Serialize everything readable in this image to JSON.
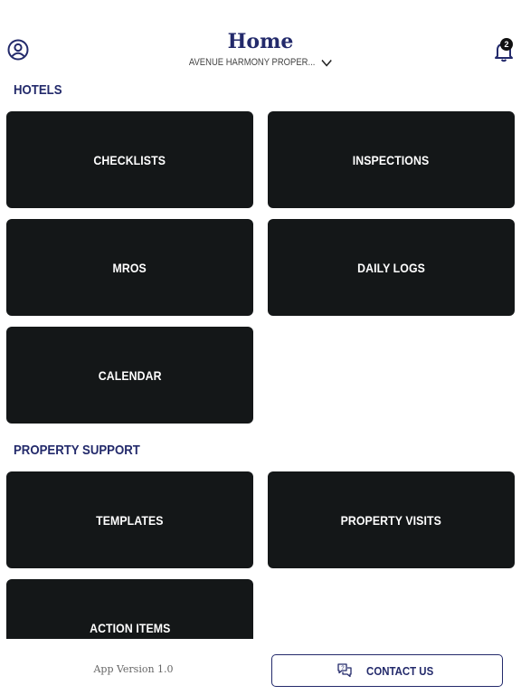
{
  "header": {
    "title": "Home",
    "property_name": "AVENUE HARMONY PROPER...",
    "notification_count": "2"
  },
  "sections": {
    "hotels": {
      "title": "HOTELS",
      "tiles": [
        "CHECKLISTS",
        "INSPECTIONS",
        "MROS",
        "DAILY LOGS",
        "CALENDAR"
      ]
    },
    "property_support": {
      "title": "PROPERTY SUPPORT",
      "tiles": [
        "TEMPLATES",
        "PROPERTY VISITS",
        "ACTION ITEMS"
      ]
    }
  },
  "footer": {
    "version": "App Version 1.0",
    "contact_label": "CONTACT US"
  },
  "colors": {
    "brand": "#232a6b",
    "tile_bg": "#141718",
    "badge_bg": "#111111"
  },
  "icons": {
    "profile": "user-circle-icon",
    "dropdown": "chevron-down-icon",
    "notifications": "bell-icon",
    "contact": "chat-bubbles-icon"
  }
}
